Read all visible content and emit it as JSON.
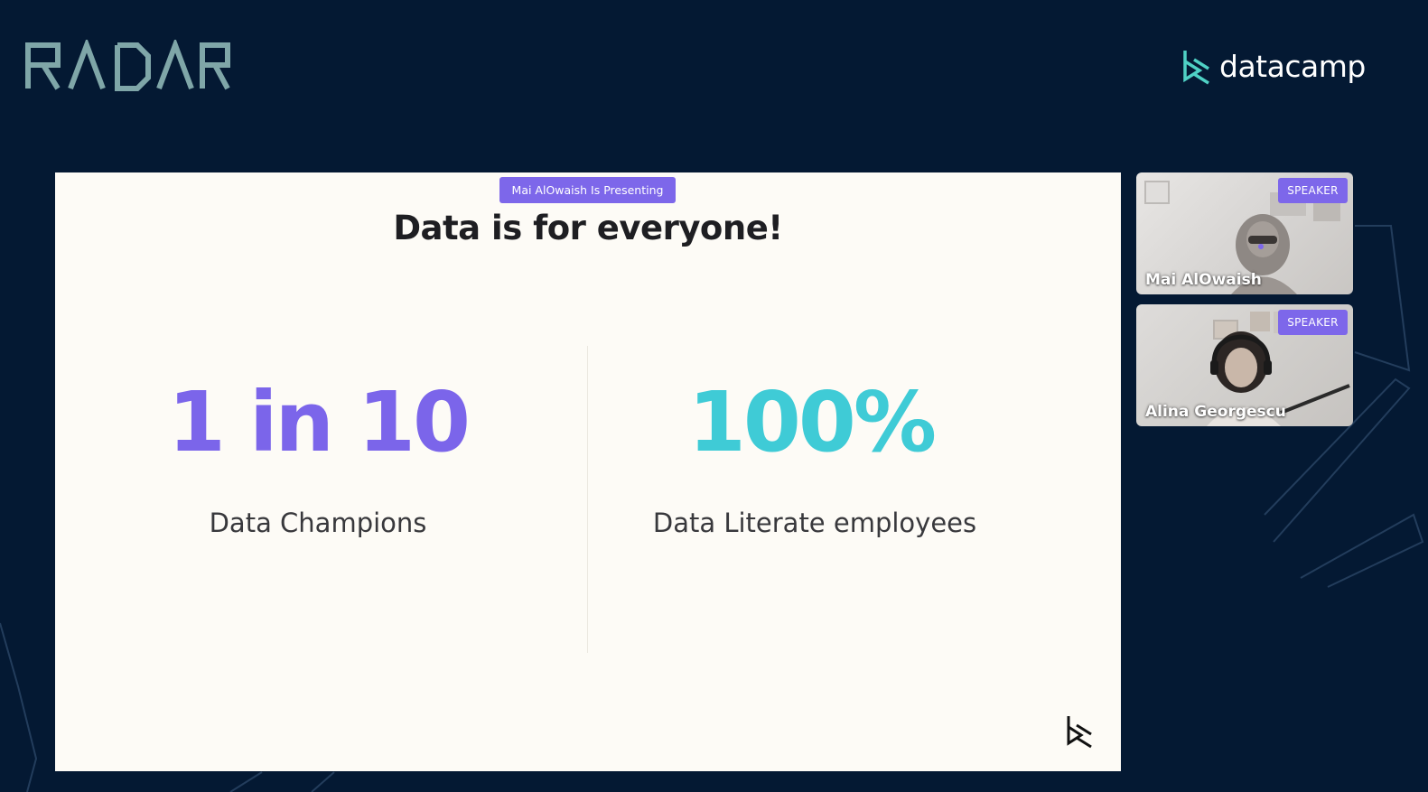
{
  "header": {
    "event_logo_text": "RADAR",
    "brand_logo_text": "datacamp"
  },
  "slide": {
    "presenting_label": "Mai AlOwaish Is Presenting",
    "title": "Data is for everyone!",
    "stats": [
      {
        "value": "1 in 10",
        "label": "Data Champions",
        "color": "#7b65ea"
      },
      {
        "value": "100%",
        "label": "Data Literate employees",
        "color": "#3fcbd6"
      }
    ]
  },
  "speakers": [
    {
      "name": "Mai AlOwaish",
      "badge": "SPEAKER"
    },
    {
      "name": "Alina Georgescu",
      "badge": "SPEAKER"
    }
  ],
  "colors": {
    "background": "#041933",
    "accent_purple": "#7d67ea",
    "accent_teal": "#3fcbd6",
    "slide_background": "#fdfbf6"
  }
}
